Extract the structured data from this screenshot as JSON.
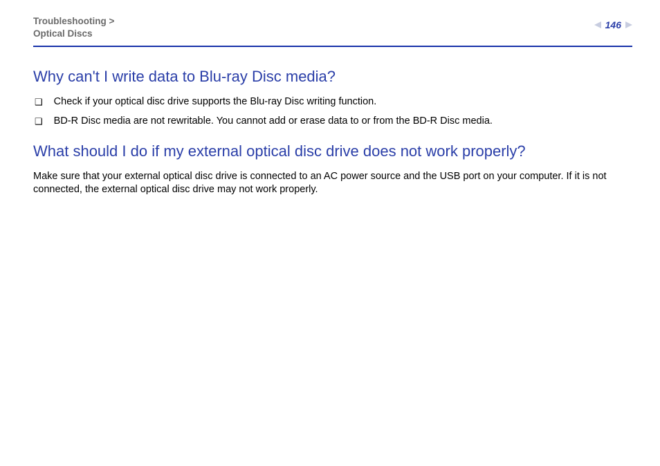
{
  "header": {
    "breadcrumb_line1": "Troubleshooting >",
    "breadcrumb_line2": "Optical Discs",
    "page_number": "146"
  },
  "sections": {
    "s1": {
      "title": "Why can't I write data to Blu-ray Disc media?",
      "bullets": [
        "Check if your optical disc drive supports the Blu-ray Disc writing function.",
        "BD-R Disc media are not rewritable. You cannot add or erase data to or from the BD-R Disc media."
      ]
    },
    "s2": {
      "title": "What should I do if my external optical disc drive does not work properly?",
      "body": "Make sure that your external optical disc drive is connected to an AC power source and the USB port on your computer. If it is not connected, the external optical disc drive may not work properly."
    }
  }
}
